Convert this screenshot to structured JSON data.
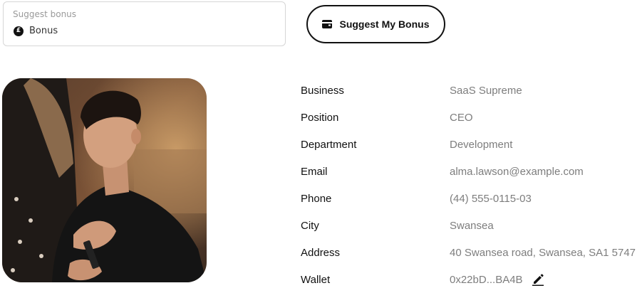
{
  "bonus_field": {
    "label": "Suggest bonus",
    "value": "Bonus",
    "icon": "pound-icon"
  },
  "suggest_button": {
    "label": "Suggest My Bonus",
    "icon": "wallet-icon"
  },
  "profile": {
    "photo": "profile-photo",
    "details": [
      {
        "label": "Business",
        "value": "SaaS Supreme"
      },
      {
        "label": "Position",
        "value": "CEO"
      },
      {
        "label": "Department",
        "value": "Development"
      },
      {
        "label": "Email",
        "value": "alma.lawson@example.com"
      },
      {
        "label": "Phone",
        "value": "(44) 555-0115-03"
      },
      {
        "label": "City",
        "value": "Swansea"
      },
      {
        "label": "Address",
        "value": "40 Swansea road, Swansea, SA1 5747"
      },
      {
        "label": "Wallet",
        "value": "0x22bD...BA4B",
        "icon": "edit-pencil-icon"
      }
    ]
  }
}
